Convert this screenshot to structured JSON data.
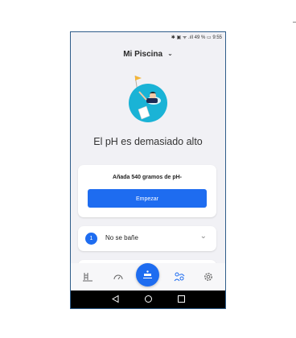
{
  "status_bar": {
    "text": "✱ ▣ ᯤ .ıll 49 % ▭ 9:55"
  },
  "header": {
    "pool_name": "Mi Piscina",
    "dropdown_icon": "chevron-down-icon"
  },
  "hero": {
    "title": "El pH es demasiado alto"
  },
  "action_card": {
    "message": "Añada 540 gramos de pH-",
    "button_label": "Empezar"
  },
  "steps": [
    {
      "number": "1",
      "label": "No se bañe"
    }
  ],
  "colors": {
    "accent": "#1e6cf0",
    "teal": "#1ab3d6",
    "background": "#f1f1f5"
  },
  "tab_bar": {
    "icons": [
      "pool-icon",
      "gauge-icon",
      "treatment-icon",
      "people-icon",
      "gear-icon"
    ]
  },
  "nav_bar": {
    "icons": [
      "back-icon",
      "home-icon",
      "recents-icon"
    ]
  }
}
